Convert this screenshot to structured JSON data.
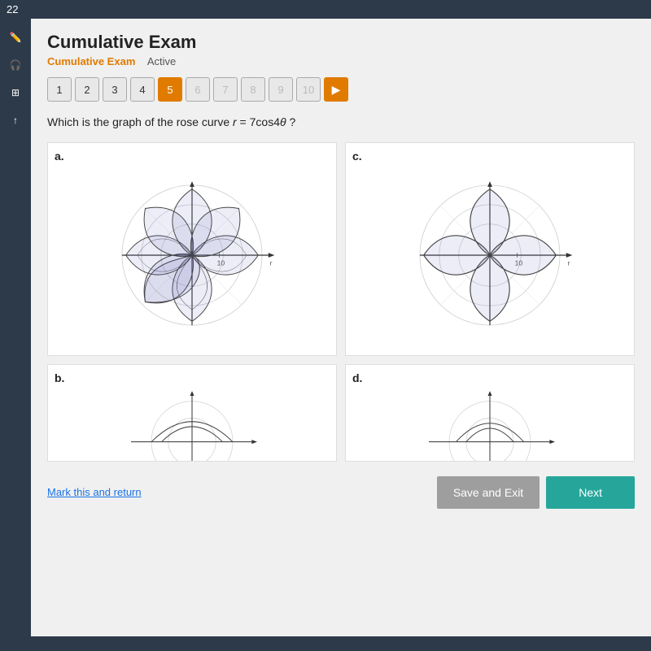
{
  "topbar": {
    "number": "22"
  },
  "exam": {
    "title": "Cumulative Exam",
    "subtitle": "Cumulative Exam",
    "status": "Active"
  },
  "nav": {
    "buttons": [
      "1",
      "2",
      "3",
      "4",
      "5",
      "6",
      "7",
      "8",
      "9",
      "10"
    ],
    "active_index": 4
  },
  "question": {
    "text": "Which is the graph of the rose curve r = 7cos4θ ?"
  },
  "options": [
    {
      "label": "a.",
      "petals": 8
    },
    {
      "label": "b.",
      "petals": 2
    },
    {
      "label": "c.",
      "petals": 4
    },
    {
      "label": "d.",
      "petals": 2
    }
  ],
  "footer": {
    "mark_return": "Mark this and return",
    "save_exit": "Save and Exit",
    "next": "Next"
  },
  "sidebar_icons": [
    "pencil",
    "headphones",
    "grid",
    "arrow-up"
  ]
}
